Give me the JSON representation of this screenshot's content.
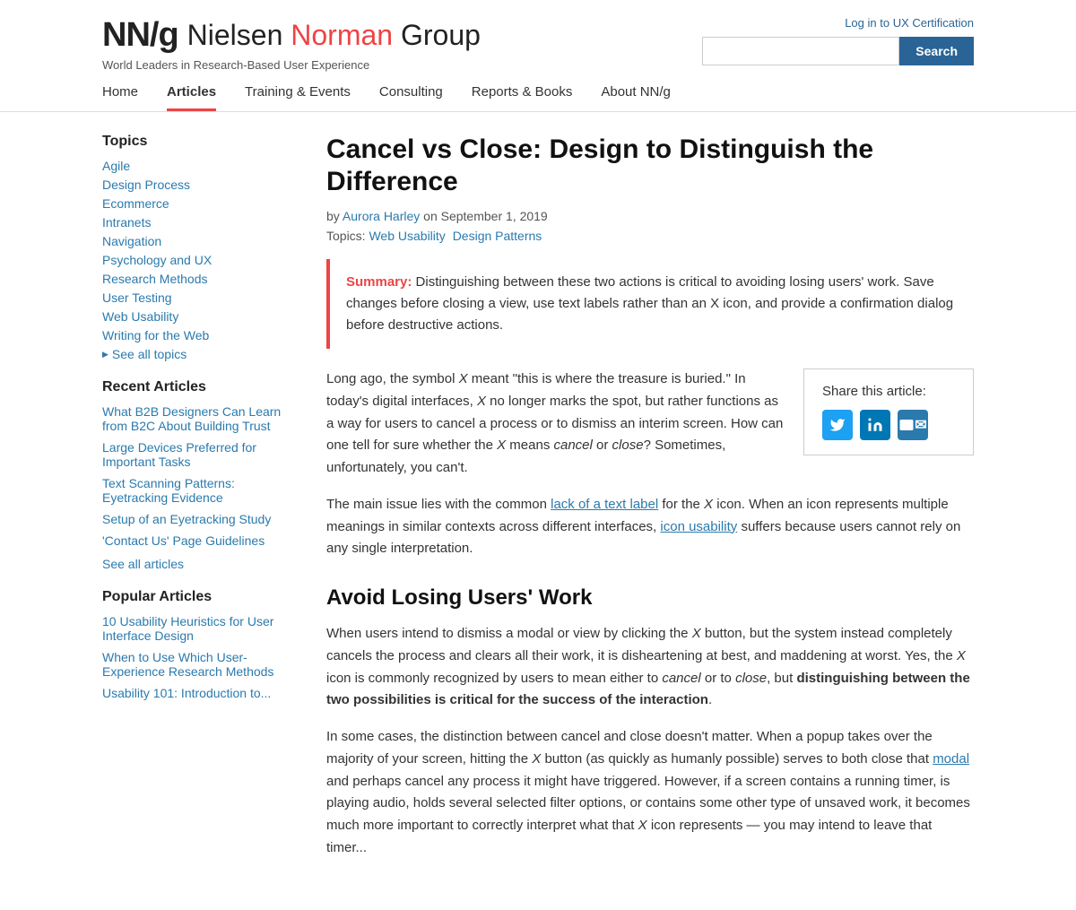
{
  "header": {
    "logo_bold": "NN/g",
    "logo_name_black": "Nielsen ",
    "logo_name_red": "Norman",
    "logo_name_rest": " Group",
    "tagline": "World Leaders in Research-Based User Experience",
    "login_text": "Log in to UX Certification",
    "search_placeholder": "",
    "search_button": "Search"
  },
  "nav": {
    "items": [
      {
        "label": "Home",
        "active": false
      },
      {
        "label": "Articles",
        "active": true
      },
      {
        "label": "Training & Events",
        "active": false
      },
      {
        "label": "Consulting",
        "active": false
      },
      {
        "label": "Reports & Books",
        "active": false
      },
      {
        "label": "About NN/g",
        "active": false
      }
    ]
  },
  "sidebar": {
    "topics_title": "Topics",
    "topics": [
      "Agile",
      "Design Process",
      "Ecommerce",
      "Intranets",
      "Navigation",
      "Psychology and UX",
      "Research Methods",
      "User Testing",
      "Web Usability",
      "Writing for the Web"
    ],
    "see_topics": "See all topics",
    "recent_title": "Recent Articles",
    "recent": [
      "What B2B Designers Can Learn from B2C About Building Trust",
      "Large Devices Preferred for Important Tasks",
      "Text Scanning Patterns: Eyetracking Evidence",
      "Setup of an Eyetracking Study",
      "'Contact Us' Page Guidelines"
    ],
    "see_articles": "See all articles",
    "popular_title": "Popular Articles",
    "popular": [
      "10 Usability Heuristics for User Interface Design",
      "When to Use Which User-Experience Research Methods",
      "Usability 101: Introduction to..."
    ]
  },
  "article": {
    "title": "Cancel vs Close: Design to Distinguish the Difference",
    "author": "Aurora Harley",
    "date": "September 1, 2019",
    "topics_label": "Topics:",
    "topics": [
      "Web Usability",
      "Design Patterns"
    ],
    "summary_label": "Summary:",
    "summary_text": "Distinguishing between these two actions is critical to avoiding losing users' work. Save changes before closing a view, use text labels rather than an X icon, and provide a confirmation dialog before destructive actions.",
    "share_label": "Share this article:",
    "para1_before": "Long ago, the symbol ",
    "para1_x1": "X",
    "para1_mid": " meant “this is where the treasure is buried.” In today’s digital interfaces, ",
    "para1_x2": "X",
    "para1_cont": " no longer marks the spot, but rather functions as a way for users to cancel a process or to dismiss an interim screen. How can one tell for sure whether the ",
    "para1_x3": "X",
    "para1_end1": " means ",
    "para1_cancel": "cancel",
    "para1_or": " or ",
    "para1_close": "close",
    "para1_end": "? Sometimes, unfortunately, you can’t.",
    "para2_before": "The main issue lies with the common ",
    "para2_link1": "lack of a text label",
    "para2_mid": " for the ",
    "para2_x": "X",
    "para2_cont": " icon. When an icon represents multiple meanings in similar contexts across different interfaces, ",
    "para2_link2": "icon usability",
    "para2_end": " suffers because users cannot rely on any single interpretation.",
    "section1_title": "Avoid Losing Users’ Work",
    "section1_para1_before": "When users intend to dismiss a modal or view by clicking the ",
    "section1_x1": "X",
    "section1_para1_cont": " button, but the system instead completely cancels the process and clears all their work, it is disheartening at best, and maddening at worst. Yes, the ",
    "section1_x2": "X",
    "section1_para1_mid": " icon is commonly recognized by users to mean either to ",
    "section1_cancel": "cancel",
    "section1_or": " or to ",
    "section1_close": "close",
    "section1_comma": ", but ",
    "section1_bold": "distinguishing between the two possibilities is critical for the success of the interaction",
    "section1_period": ".",
    "section1_para2_before": "In some cases, the distinction between cancel and close doesn’t matter. When a popup takes over the majority of your screen, hitting the ",
    "section1_x3": "X",
    "section1_para2_cont": " button (as quickly as humanly possible) serves to both close that ",
    "section1_modal_link": "modal",
    "section1_para2_end": " and perhaps cancel any process it might have triggered. However, if a screen contains a running timer, is playing audio, holds several selected filter options, or contains some other type of unsaved work, it becomes much more important to correctly interpret what that ",
    "section1_x4": "X",
    "section1_para2_last": " icon represents — you may intend to leave that timer..."
  }
}
